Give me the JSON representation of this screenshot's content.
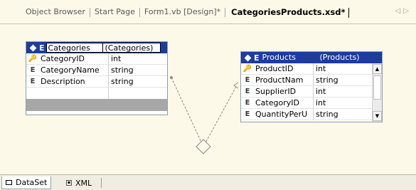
{
  "tabs": {
    "items": [
      "Object Browser",
      "Start Page",
      "Form1.vb [Design]*"
    ],
    "active": "CategoriesProducts.xsd*",
    "nav_left": "◁",
    "nav_right": "▷"
  },
  "categories": {
    "element_marker": "E",
    "name": "Categories",
    "type": "(Categories)",
    "rows": [
      {
        "icon": "E",
        "key": true,
        "name": "CategoryID",
        "type": "int"
      },
      {
        "icon": "E",
        "key": false,
        "name": "CategoryName",
        "type": "string"
      },
      {
        "icon": "E",
        "key": false,
        "name": "Description",
        "type": "string"
      }
    ]
  },
  "products": {
    "element_marker": "E",
    "name": "Products",
    "type": "(Products)",
    "rows": [
      {
        "icon": "E",
        "key": true,
        "name": "ProductID",
        "type": "int"
      },
      {
        "icon": "E",
        "key": false,
        "name": "ProductNam",
        "type": "string"
      },
      {
        "icon": "E",
        "key": false,
        "name": "SupplierID",
        "type": "int"
      },
      {
        "icon": "E",
        "key": false,
        "name": "CategoryID",
        "type": "int"
      },
      {
        "icon": "E",
        "key": false,
        "name": "QuantityPerU",
        "type": "string"
      }
    ]
  },
  "bottom_tabs": {
    "dataset": "DataSet",
    "xml": "XML"
  },
  "colors": {
    "canvas": "#fcf9e8",
    "header": "#1c3c9e",
    "footer": "#a7a7a7"
  }
}
